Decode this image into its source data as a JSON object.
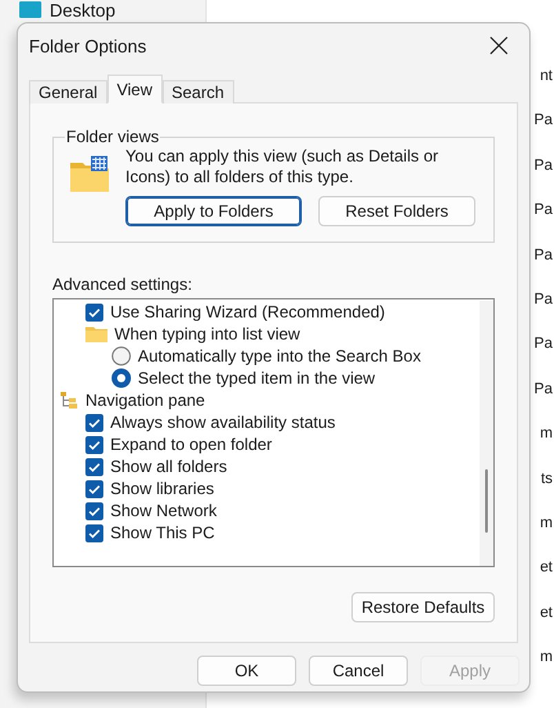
{
  "background": {
    "sidebar_item": "Desktop",
    "edge_texts": [
      "nt",
      "Pa",
      "Pa",
      "Pa",
      "Pa",
      "Pa",
      "Pa",
      "Pa",
      "m",
      "ts",
      "m",
      "et",
      "et",
      "m"
    ]
  },
  "window": {
    "title": "Folder Options"
  },
  "tabs": [
    {
      "label": "General",
      "selected": false
    },
    {
      "label": "View",
      "selected": true
    },
    {
      "label": "Search",
      "selected": false
    }
  ],
  "folder_views": {
    "title": "Folder views",
    "text": "You can apply this view (such as Details or Icons) to all folders of this type.",
    "buttons": [
      {
        "label": "Apply to Folders",
        "focused": true
      },
      {
        "label": "Reset Folders",
        "focused": false
      }
    ]
  },
  "advanced": {
    "label": "Advanced settings:",
    "continued": [
      {
        "kind": "checkbox",
        "label": "Use Sharing Wizard (Recommended)",
        "checked": true
      },
      {
        "kind": "folder",
        "label": "When typing into list view",
        "children": [
          {
            "kind": "radio",
            "label": "Automatically type into the Search Box",
            "selected": false
          },
          {
            "kind": "radio",
            "label": "Select the typed item in the view",
            "selected": true
          }
        ]
      }
    ],
    "items": [
      {
        "kind": "tree",
        "label": "Navigation pane",
        "children": [
          {
            "kind": "checkbox",
            "label": "Always show availability status",
            "checked": true
          },
          {
            "kind": "checkbox",
            "label": "Expand to open folder",
            "checked": true
          },
          {
            "kind": "checkbox",
            "label": "Show all folders",
            "checked": true
          },
          {
            "kind": "checkbox",
            "label": "Show libraries",
            "checked": true
          },
          {
            "kind": "checkbox",
            "label": "Show Network",
            "checked": true
          },
          {
            "kind": "checkbox",
            "label": "Show This PC",
            "checked": true
          }
        ]
      }
    ],
    "restore": "Restore Defaults"
  },
  "buttons": [
    {
      "label": "OK",
      "disabled": false
    },
    {
      "label": "Cancel",
      "disabled": false
    },
    {
      "label": "Apply",
      "disabled": true
    }
  ]
}
